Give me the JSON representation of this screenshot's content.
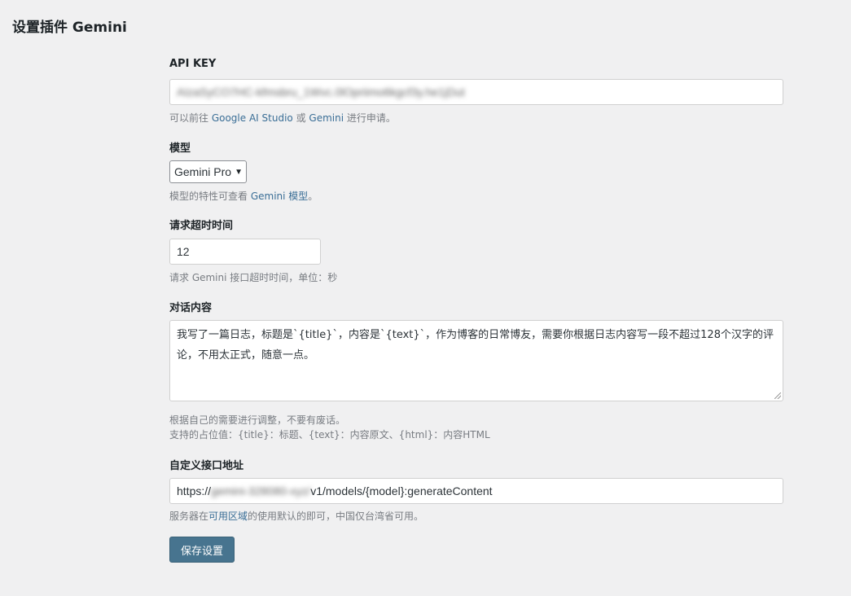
{
  "page": {
    "title": "设置插件 Gemini"
  },
  "api_key": {
    "label": "API KEY",
    "value": "AIzaSyCO7HC-kfmsbru_1Wvc.0lOpriimo6kgcf3y.he1jDut",
    "desc_prefix": "可以前往 ",
    "link1": "Google AI Studio",
    "desc_mid": " 或 ",
    "link2": "Gemini",
    "desc_suffix": " 进行申请。"
  },
  "model": {
    "label": "模型",
    "selected": "Gemini Pro",
    "desc_prefix": "模型的特性可查看 ",
    "link": "Gemini 模型",
    "desc_suffix": "。"
  },
  "timeout": {
    "label": "请求超时时间",
    "value": "12",
    "desc": "请求 Gemini 接口超时时间，单位：秒"
  },
  "prompt": {
    "label": "对话内容",
    "value": "我写了一篇日志，标题是`{title}`，内容是`{text}`，作为博客的日常博友，需要你根据日志内容写一段不超过128个汉字的评论，不用太正式，随意一点。",
    "desc1": "根据自己的需要进行调整，不要有废话。",
    "desc2": "支持的占位值：{title}：标题、{text}：内容原文、{html}：内容HTML"
  },
  "endpoint": {
    "label": "自定义接口地址",
    "value_prefix": "https://",
    "value_masked": "gemini-328080-xyz/",
    "value_suffix": "v1/models/{model}:generateContent",
    "desc_prefix": "服务器在",
    "link": "可用区域",
    "desc_suffix": "的使用默认的即可，中国仅台湾省可用。"
  },
  "save_button": "保存设置"
}
